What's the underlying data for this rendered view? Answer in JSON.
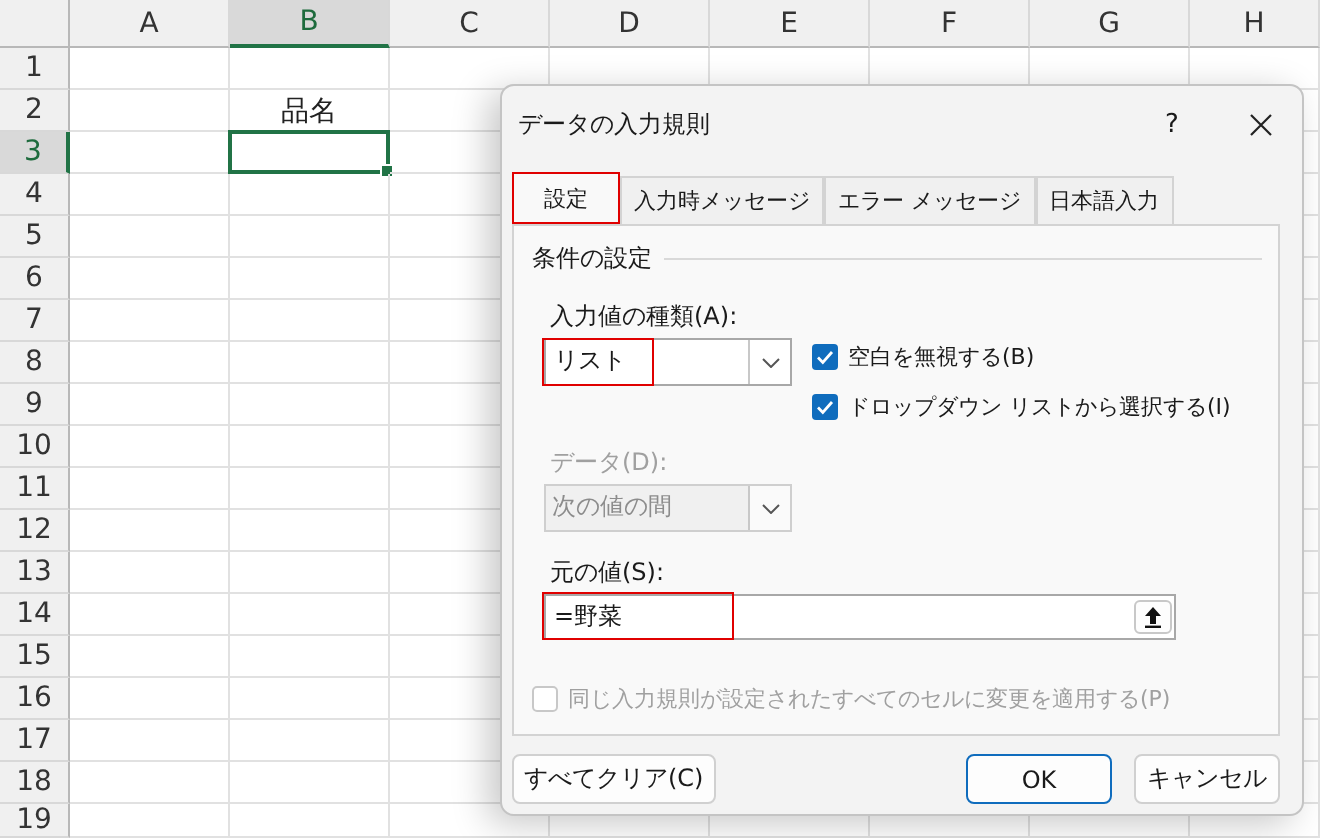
{
  "sheet": {
    "columns": [
      {
        "label": "A",
        "selected": false
      },
      {
        "label": "B",
        "selected": true
      },
      {
        "label": "C",
        "selected": false
      },
      {
        "label": "D",
        "selected": false
      },
      {
        "label": "E",
        "selected": false
      },
      {
        "label": "F",
        "selected": false
      },
      {
        "label": "G",
        "selected": false
      },
      {
        "label": "H",
        "selected": false
      }
    ],
    "rows": [
      {
        "label": "1",
        "selected": false
      },
      {
        "label": "2",
        "selected": false,
        "cells": {
          "B": "品名"
        }
      },
      {
        "label": "3",
        "selected": true
      },
      {
        "label": "4",
        "selected": false
      },
      {
        "label": "5",
        "selected": false
      },
      {
        "label": "6",
        "selected": false
      },
      {
        "label": "7",
        "selected": false
      },
      {
        "label": "8",
        "selected": false
      },
      {
        "label": "9",
        "selected": false
      },
      {
        "label": "10",
        "selected": false
      },
      {
        "label": "11",
        "selected": false
      },
      {
        "label": "12",
        "selected": false
      },
      {
        "label": "13",
        "selected": false
      },
      {
        "label": "14",
        "selected": false
      },
      {
        "label": "15",
        "selected": false
      },
      {
        "label": "16",
        "selected": false
      },
      {
        "label": "17",
        "selected": false
      },
      {
        "label": "18",
        "selected": false
      },
      {
        "label": "19",
        "selected": false
      }
    ]
  },
  "dialog": {
    "title": "データの入力規則",
    "help": "?",
    "tabs": [
      {
        "label": "設定",
        "selected": true,
        "highlighted": true
      },
      {
        "label": "入力時メッセージ",
        "selected": false,
        "highlighted": false
      },
      {
        "label": "エラー メッセージ",
        "selected": false,
        "highlighted": false
      },
      {
        "label": "日本語入力",
        "selected": false,
        "highlighted": false
      }
    ],
    "group_title": "条件の設定",
    "allow": {
      "label": "入力値の種類(A):",
      "value": "リスト",
      "highlighted": true
    },
    "options": [
      {
        "label": "空白を無視する(B)",
        "checked": true
      },
      {
        "label": "ドロップダウン リストから選択する(I)",
        "checked": true
      }
    ],
    "data": {
      "label": "データ(D):",
      "value": "次の値の間",
      "disabled": true
    },
    "source": {
      "label": "元の値(S):",
      "value": "=野菜",
      "highlighted": true
    },
    "apply_all": {
      "label": "同じ入力規則が設定されたすべてのセルに変更を適用する(P)",
      "checked": false,
      "disabled": true
    },
    "buttons": [
      {
        "label": "すべてクリア(C)",
        "default": false
      },
      {
        "label": "OK",
        "default": true
      },
      {
        "label": "キャンセル",
        "default": false
      }
    ]
  }
}
